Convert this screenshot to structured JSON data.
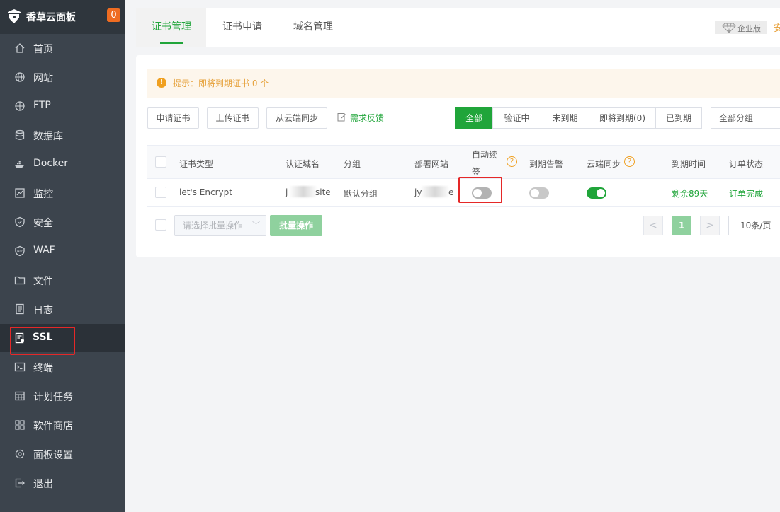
{
  "brand": {
    "name": "香草云面板",
    "badge": "0"
  },
  "sidebar": {
    "items": [
      {
        "label": "首页",
        "icon": "home-icon"
      },
      {
        "label": "网站",
        "icon": "globe-icon"
      },
      {
        "label": "FTP",
        "icon": "ftp-icon"
      },
      {
        "label": "数据库",
        "icon": "database-icon"
      },
      {
        "label": "Docker",
        "icon": "docker-icon"
      },
      {
        "label": "监控",
        "icon": "monitor-icon"
      },
      {
        "label": "安全",
        "icon": "shield-icon"
      },
      {
        "label": "WAF",
        "icon": "waf-shield-icon"
      },
      {
        "label": "文件",
        "icon": "folder-icon"
      },
      {
        "label": "日志",
        "icon": "log-icon"
      },
      {
        "label": "SSL",
        "icon": "ssl-certificate-icon"
      },
      {
        "label": "终端",
        "icon": "terminal-icon"
      },
      {
        "label": "计划任务",
        "icon": "calendar-icon"
      },
      {
        "label": "软件商店",
        "icon": "grid-apps-icon"
      },
      {
        "label": "面板设置",
        "icon": "gear-icon"
      },
      {
        "label": "退出",
        "icon": "logout-icon"
      }
    ],
    "active": "SSL"
  },
  "tabs": [
    {
      "label": "证书管理",
      "active": true
    },
    {
      "label": "证书申请",
      "active": false
    },
    {
      "label": "域名管理",
      "active": false
    }
  ],
  "header": {
    "edition": "企业版",
    "edition_extra": "安"
  },
  "alert": {
    "text": "提示：即将到期证书 0 个"
  },
  "toolbar": {
    "apply": "申请证书",
    "upload": "上传证书",
    "sync": "从云端同步",
    "feedback": "需求反馈"
  },
  "filters": [
    {
      "label": "全部",
      "active": true
    },
    {
      "label": "验证中",
      "active": false
    },
    {
      "label": "未到期",
      "active": false
    },
    {
      "label": "即将到期(0)",
      "active": false
    },
    {
      "label": "已到期",
      "active": false
    }
  ],
  "group_select": {
    "value": "全部分组"
  },
  "table": {
    "headers": {
      "type": "证书类型",
      "domain": "认证域名",
      "group": "分组",
      "site": "部署网站",
      "auto_renew_line1": "自动续",
      "auto_renew_line2": "签",
      "expire_alert": "到期告警",
      "cloud_sync": "云端同步",
      "expire_time": "到期时间",
      "order_status": "订单状态"
    },
    "rows": [
      {
        "type": "let's Encrypt",
        "domain_start": "j",
        "domain_end": "site",
        "group": "默认分组",
        "site_start": "jy",
        "site_end": "e",
        "auto_renew": false,
        "expire_alert": false,
        "cloud_sync": true,
        "expire_time": "剩余89天",
        "order_status": "订单完成"
      }
    ]
  },
  "batch": {
    "placeholder": "请选择批量操作",
    "button": "批量操作"
  },
  "pagination": {
    "prev": "<",
    "current": "1",
    "next": ">",
    "page_size": "10条/页"
  },
  "colors": {
    "accent": "#20a53a",
    "sidebar": "#3c444d",
    "warning": "#e6a23c",
    "highlight": "#e52828"
  }
}
